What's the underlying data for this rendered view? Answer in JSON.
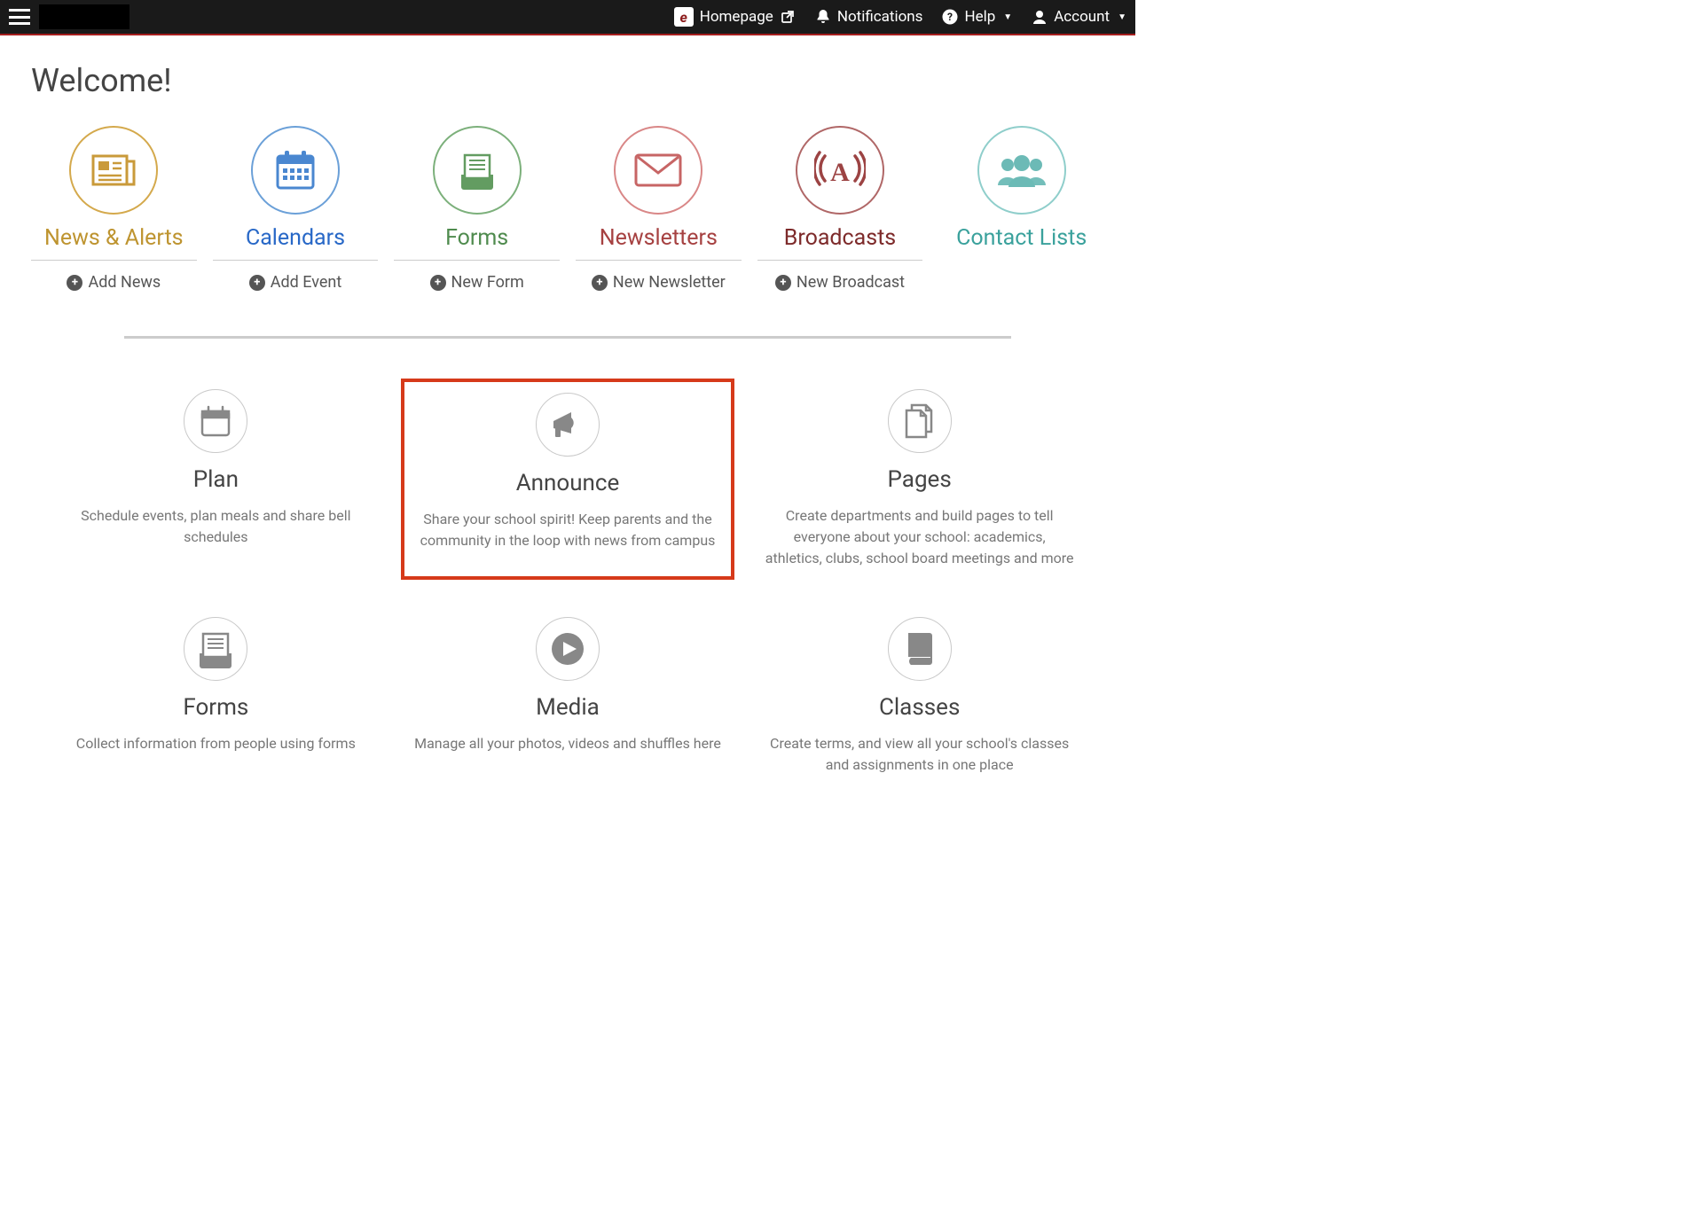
{
  "header": {
    "homepage": "Homepage",
    "notifications": "Notifications",
    "help": "Help",
    "account": "Account"
  },
  "welcome": "Welcome!",
  "nav": [
    {
      "label": "News & Alerts",
      "action": "Add News",
      "color": "gold",
      "icon": "news"
    },
    {
      "label": "Calendars",
      "action": "Add Event",
      "color": "blue",
      "icon": "calendar"
    },
    {
      "label": "Forms",
      "action": "New Form",
      "color": "green",
      "icon": "form"
    },
    {
      "label": "Newsletters",
      "action": "New Newsletter",
      "color": "red",
      "icon": "envelope"
    },
    {
      "label": "Broadcasts",
      "action": "New Broadcast",
      "color": "maroon",
      "icon": "broadcast"
    },
    {
      "label": "Contact Lists",
      "action": "",
      "color": "teal",
      "icon": "contacts"
    }
  ],
  "features": [
    {
      "title": "Plan",
      "desc": "Schedule events, plan meals and share bell schedules",
      "icon": "plan",
      "highlight": false
    },
    {
      "title": "Announce",
      "desc": "Share your school spirit! Keep parents and the community in the loop with news from campus",
      "icon": "announce",
      "highlight": true
    },
    {
      "title": "Pages",
      "desc": "Create departments and build pages to tell everyone about your school: academics, athletics, clubs, school board meetings and more",
      "icon": "pages",
      "highlight": false
    },
    {
      "title": "Forms",
      "desc": "Collect information from people using forms",
      "icon": "form-gray",
      "highlight": false
    },
    {
      "title": "Media",
      "desc": "Manage all your photos, videos and shuffles here",
      "icon": "media",
      "highlight": false
    },
    {
      "title": "Classes",
      "desc": "Create terms, and view all your school's classes and assignments in one place",
      "icon": "classes",
      "highlight": false
    }
  ],
  "icon_colors": {
    "gold": "#c99a3a",
    "blue": "#4a87d0",
    "green": "#639c61",
    "red": "#c76565",
    "maroon": "#9c4343",
    "teal": "#6cbab6",
    "gray": "#888"
  }
}
